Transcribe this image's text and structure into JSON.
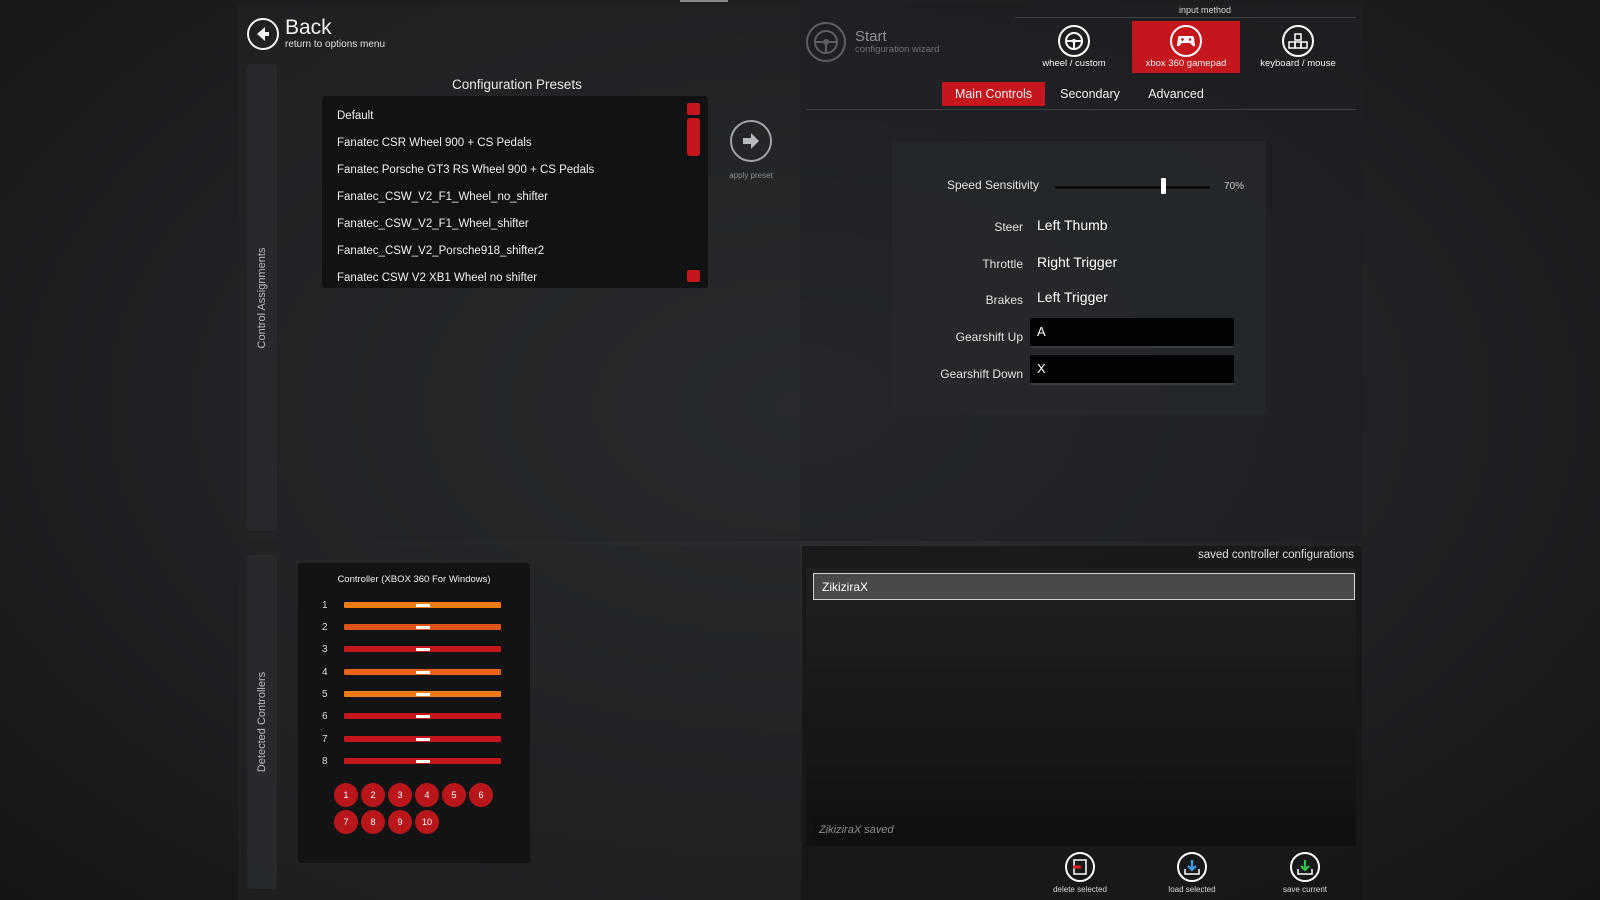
{
  "back": {
    "title": "Back",
    "subtitle": "return to options menu"
  },
  "side_labels": {
    "assignments": "Control Assignments",
    "detected": "Detected Controllers"
  },
  "presets": {
    "title": "Configuration Presets",
    "items": [
      "Default",
      "Fanatec CSR Wheel 900 + CS Pedals",
      "Fanatec Porsche GT3 RS Wheel 900 + CS Pedals",
      "Fanatec_CSW_V2_F1_Wheel_no_shifter",
      "Fanatec_CSW_V2_F1_Wheel_shifter",
      "Fanatec_CSW_V2_Porsche918_shifter2",
      "Fanatec CSW V2 XB1 Wheel no shifter"
    ],
    "apply_label": "apply preset"
  },
  "wizard": {
    "title": "Start",
    "subtitle": "configuration wizard"
  },
  "input_method": {
    "label": "input method",
    "options": [
      {
        "label": "wheel / custom",
        "icon": "steering-wheel-icon"
      },
      {
        "label": "xbox 360 gamepad",
        "icon": "gamepad-icon",
        "active": true
      },
      {
        "label": "keyboard / mouse",
        "icon": "keyboard-icon"
      }
    ]
  },
  "tabs": [
    "Main Controls",
    "Secondary",
    "Advanced"
  ],
  "controls": {
    "speed_sensitivity": {
      "label": "Speed Sensitivity",
      "value": "70%",
      "fraction": 0.7
    },
    "steer": {
      "label": "Steer",
      "value": "Left Thumb"
    },
    "throttle": {
      "label": "Throttle",
      "value": "Right Trigger"
    },
    "brakes": {
      "label": "Brakes",
      "value": "Left Trigger"
    },
    "gearshift_up": {
      "label": "Gearshift Up",
      "value": "A"
    },
    "gearshift_down": {
      "label": "Gearshift Down",
      "value": "X"
    }
  },
  "controller": {
    "title": "Controller (XBOX 360 For Windows)",
    "axes": [
      {
        "num": "1",
        "color": "#f07b12"
      },
      {
        "num": "2",
        "color": "#e0541a"
      },
      {
        "num": "3",
        "color": "#c4161c"
      },
      {
        "num": "4",
        "color": "#e8621a"
      },
      {
        "num": "5",
        "color": "#f07b12"
      },
      {
        "num": "6",
        "color": "#c4161c"
      },
      {
        "num": "7",
        "color": "#c4161c"
      },
      {
        "num": "8",
        "color": "#c4161c"
      }
    ],
    "buttons": [
      "1",
      "2",
      "3",
      "4",
      "5",
      "6",
      "7",
      "8",
      "9",
      "10"
    ]
  },
  "saved": {
    "title": "saved controller configurations",
    "items": [
      "ZikiziraX"
    ],
    "status": "ZikiziraX saved",
    "actions": [
      {
        "label": "delete selected",
        "icon": "delete-icon"
      },
      {
        "label": "load selected",
        "icon": "load-icon"
      },
      {
        "label": "save current",
        "icon": "save-icon"
      }
    ]
  },
  "colors": {
    "accent": "#c4161c",
    "orange": "#f07b12"
  }
}
